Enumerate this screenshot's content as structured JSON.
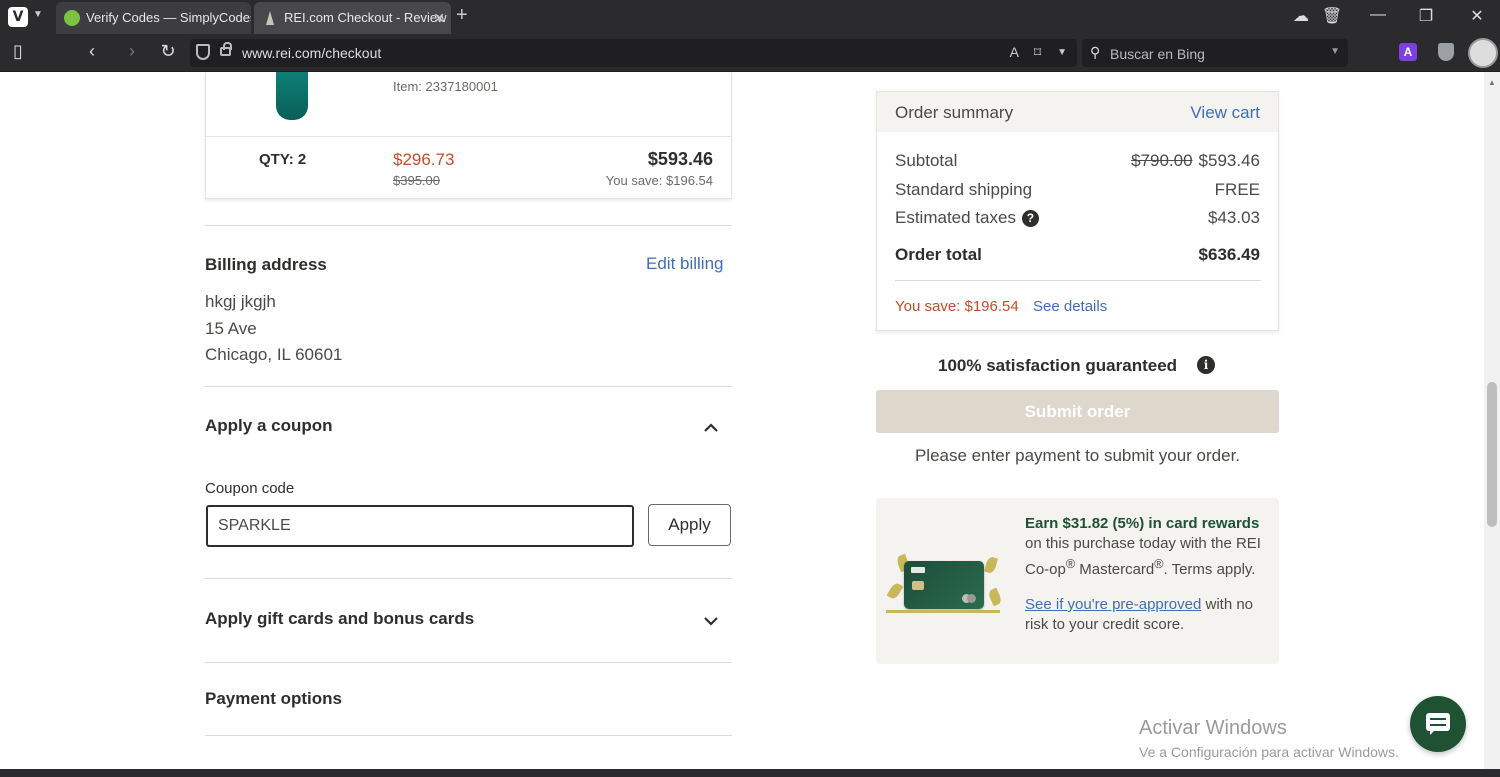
{
  "browser": {
    "logo": "V",
    "tabs": [
      {
        "title": "Verify Codes — SimplyCodes",
        "favicon": "simplycodes-favicon"
      },
      {
        "title": "REI.com Checkout - Review",
        "favicon": "rei-favicon"
      }
    ],
    "url": "www.rei.com/checkout",
    "search_placeholder": "Buscar en Bing",
    "extension_label": "A"
  },
  "product": {
    "item_number": "Item: 2337180001",
    "qty": "QTY: 2",
    "sale_price": "$296.73",
    "original_price": "$395.00",
    "line_total": "$593.46",
    "line_savings": "You save: $196.54"
  },
  "billing": {
    "title": "Billing address",
    "edit_label": "Edit billing",
    "lines": [
      "hkgj jkgjh",
      "15 Ave",
      "Chicago, IL 60601"
    ]
  },
  "coupon": {
    "title": "Apply a coupon",
    "label": "Coupon code",
    "value": "SPARKLE",
    "apply_label": "Apply"
  },
  "gift_cards": {
    "title": "Apply gift cards and bonus cards"
  },
  "payment": {
    "title": "Payment options"
  },
  "summary": {
    "title": "Order summary",
    "view_cart": "View cart",
    "subtotal_label": "Subtotal",
    "subtotal_original": "$790.00",
    "subtotal_value": "$593.46",
    "shipping_label": "Standard shipping",
    "shipping_value": "FREE",
    "taxes_label": "Estimated taxes",
    "taxes_value": "$43.03",
    "total_label": "Order total",
    "total_value": "$636.49",
    "you_save": "You save: $196.54",
    "see_details": "See details"
  },
  "guarantee": "100% satisfaction guaranteed",
  "submit_label": "Submit order",
  "payment_note": "Please enter payment to submit your order.",
  "promo": {
    "title": "Earn $31.82 (5%) in card rewards",
    "body_1": "on this purchase today with the REI Co-op",
    "reg": "®",
    "body_2": " Mastercard",
    "body_3": ". Terms apply.",
    "link": "See if you're pre-approved",
    "body_4": " with no risk to your credit score."
  },
  "watermark": {
    "line1": "Activar Windows",
    "line2": "Ve a Configuración para activar Windows."
  },
  "colors": {
    "sale_red": "#c14e2a",
    "link_blue": "#406eb5",
    "rei_green": "#1f5233",
    "submit_disabled": "#ddd7cc"
  }
}
